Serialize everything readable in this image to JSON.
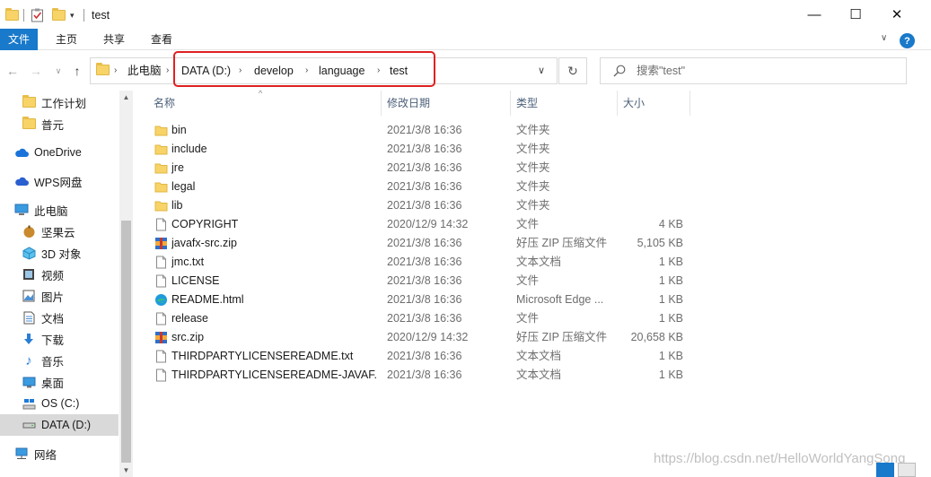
{
  "window": {
    "title": "test"
  },
  "titlebar": {
    "minimize": "—",
    "maximize": "☐",
    "close": "✕"
  },
  "ribbon": {
    "tabs": [
      "文件",
      "主页",
      "共享",
      "查看"
    ],
    "collapse_icon": "chevron-down-icon",
    "help_label": "?"
  },
  "address": {
    "crumbs": [
      "此电脑",
      "DATA (D:)",
      "develop",
      "language",
      "test"
    ],
    "highlight_color": "#e02020"
  },
  "search": {
    "placeholder": "搜索\"test\""
  },
  "sidebar": {
    "items": [
      {
        "label": "工作计划",
        "icon": "folder-icon"
      },
      {
        "label": "普元",
        "icon": "folder-icon"
      },
      {
        "label": "OneDrive",
        "icon": "cloud-icon"
      },
      {
        "label": "WPS网盘",
        "icon": "cloud-icon"
      },
      {
        "label": "此电脑",
        "icon": "computer-icon"
      },
      {
        "label": "坚果云",
        "icon": "nut-icon"
      },
      {
        "label": "3D 对象",
        "icon": "cube-icon"
      },
      {
        "label": "视频",
        "icon": "video-icon"
      },
      {
        "label": "图片",
        "icon": "picture-icon"
      },
      {
        "label": "文档",
        "icon": "document-icon"
      },
      {
        "label": "下载",
        "icon": "download-icon"
      },
      {
        "label": "音乐",
        "icon": "music-icon"
      },
      {
        "label": "桌面",
        "icon": "desktop-icon"
      },
      {
        "label": "OS (C:)",
        "icon": "drive-icon"
      },
      {
        "label": "DATA (D:)",
        "icon": "drive-icon"
      },
      {
        "label": "网络",
        "icon": "network-icon"
      }
    ]
  },
  "columns": {
    "name": "名称",
    "date": "修改日期",
    "type": "类型",
    "size": "大小"
  },
  "files": [
    {
      "name": "bin",
      "date": "2021/3/8 16:36",
      "type": "文件夹",
      "size": "",
      "icon": "folder"
    },
    {
      "name": "include",
      "date": "2021/3/8 16:36",
      "type": "文件夹",
      "size": "",
      "icon": "folder"
    },
    {
      "name": "jre",
      "date": "2021/3/8 16:36",
      "type": "文件夹",
      "size": "",
      "icon": "folder"
    },
    {
      "name": "legal",
      "date": "2021/3/8 16:36",
      "type": "文件夹",
      "size": "",
      "icon": "folder"
    },
    {
      "name": "lib",
      "date": "2021/3/8 16:36",
      "type": "文件夹",
      "size": "",
      "icon": "folder"
    },
    {
      "name": "COPYRIGHT",
      "date": "2020/12/9 14:32",
      "type": "文件",
      "size": "4 KB",
      "icon": "file"
    },
    {
      "name": "javafx-src.zip",
      "date": "2021/3/8 16:36",
      "type": "好压 ZIP 压缩文件",
      "size": "5,105 KB",
      "icon": "zip"
    },
    {
      "name": "jmc.txt",
      "date": "2021/3/8 16:36",
      "type": "文本文档",
      "size": "1 KB",
      "icon": "file"
    },
    {
      "name": "LICENSE",
      "date": "2021/3/8 16:36",
      "type": "文件",
      "size": "1 KB",
      "icon": "file"
    },
    {
      "name": "README.html",
      "date": "2021/3/8 16:36",
      "type": "Microsoft Edge ...",
      "size": "1 KB",
      "icon": "edge"
    },
    {
      "name": "release",
      "date": "2021/3/8 16:36",
      "type": "文件",
      "size": "1 KB",
      "icon": "file"
    },
    {
      "name": "src.zip",
      "date": "2020/12/9 14:32",
      "type": "好压 ZIP 压缩文件",
      "size": "20,658 KB",
      "icon": "zip"
    },
    {
      "name": "THIRDPARTYLICENSEREADME.txt",
      "date": "2021/3/8 16:36",
      "type": "文本文档",
      "size": "1 KB",
      "icon": "file"
    },
    {
      "name": "THIRDPARTYLICENSEREADME-JAVAF...",
      "date": "2021/3/8 16:36",
      "type": "文本文档",
      "size": "1 KB",
      "icon": "file"
    }
  ],
  "watermark": "https://blog.csdn.net/HelloWorldYangSong"
}
